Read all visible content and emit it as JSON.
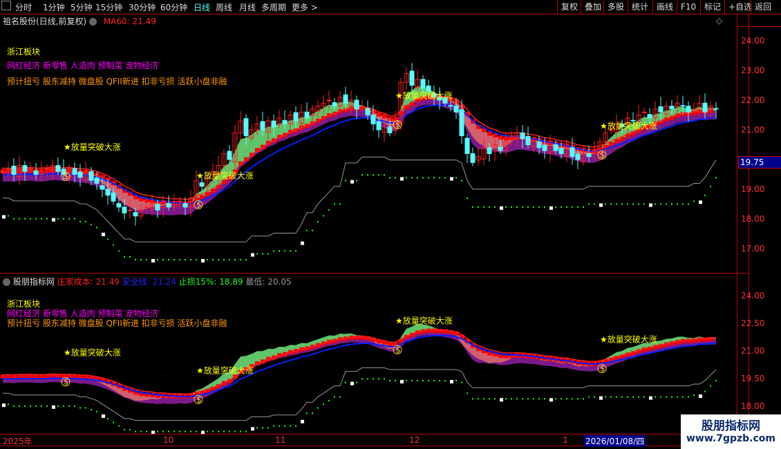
{
  "toolbar": {
    "periods": [
      "分时",
      "1分钟",
      "5分钟",
      "15分钟",
      "30分钟",
      "60分钟",
      "日线",
      "周线",
      "月线",
      "多周期",
      "更多 >"
    ],
    "active": "日线",
    "right_buttons": [
      "复权",
      "叠加",
      "多股",
      "统计",
      "画线",
      "F10",
      "标记",
      "+自选",
      "返回"
    ]
  },
  "main_pane": {
    "title": "祖名股份(日线,前复权)",
    "ma_label": "MA60: 21.49",
    "price_marker": "19.75",
    "axis_ticks": [
      "24.00",
      "23.00",
      "22.00",
      "21.00",
      "19.00",
      "18.00",
      "17.00"
    ]
  },
  "indicator_pane": {
    "name": "股朋指标网",
    "cost_label": "庄家成本: 21.49",
    "safe_label": "安全线: 21.24",
    "stop_label": "止损15%: 18.89",
    "low_label": "最低: 20.05",
    "axis_ticks": [
      "24.00",
      "22.50",
      "21.00",
      "19.50",
      "18.00"
    ]
  },
  "annotations": {
    "sector": "浙江板块",
    "concepts": "网红经济 新零售 人造肉 预制菜 宠物经济",
    "tags": "预计扭亏 股东减持 微盘股 QFII新进 扣非亏损 活跃小盘非融",
    "signal": "★放量突破大涨"
  },
  "date_axis": [
    "2025年",
    "10",
    "11",
    "12",
    "1",
    "2026/01/08/四"
  ],
  "watermark": {
    "name": "股朋指标网",
    "url": "www.7gpzb.com"
  },
  "colors": {
    "up": "#ff2020",
    "down": "#54ffff",
    "ma": "#ff2020",
    "safe": "#0020ff",
    "band_up": "#5fc46a",
    "band_down": "#d0606e",
    "band_low": "#7a1a8a",
    "stop": "#999999"
  },
  "chart_data": {
    "type": "candlestick",
    "ylim_main": [
      16.6,
      24.4
    ],
    "ylim_indicator": [
      17.8,
      24.4
    ],
    "x_labels": [
      "2025年",
      "10",
      "11",
      "12",
      "1"
    ],
    "close": [
      19.6,
      19.7,
      19.5,
      19.8,
      19.6,
      19.7,
      19.5,
      19.6,
      19.7,
      19.8,
      19.6,
      19.5,
      19.7,
      19.5,
      19.4,
      19.6,
      19.3,
      19.2,
      19.0,
      18.8,
      18.6,
      18.4,
      18.2,
      18.3,
      18.1,
      18.3,
      18.4,
      18.5,
      18.3,
      18.6,
      18.4,
      18.5,
      18.6,
      18.4,
      18.7,
      19.3,
      19.1,
      19.4,
      19.6,
      19.8,
      20.2,
      20.0,
      20.9,
      21.3,
      20.8,
      21.0,
      21.2,
      21.0,
      21.3,
      21.1,
      21.4,
      21.2,
      21.5,
      21.3,
      21.6,
      21.4,
      21.7,
      21.8,
      21.9,
      22.0,
      21.8,
      22.1,
      21.9,
      22.0,
      21.7,
      21.8,
      21.5,
      21.2,
      21.0,
      21.1,
      20.9,
      21.3,
      22.6,
      22.9,
      22.5,
      22.7,
      22.4,
      22.3,
      22.1,
      22.0,
      21.9,
      21.8,
      21.6,
      20.8,
      20.2,
      19.9,
      20.1,
      20.4,
      20.2,
      20.5,
      20.3,
      20.6,
      20.8,
      20.9,
      20.7,
      20.5,
      20.6,
      20.4,
      20.3,
      20.5,
      20.3,
      20.2,
      20.4,
      20.1,
      20.0,
      20.2,
      20.1,
      20.3,
      20.6,
      20.9,
      21.0,
      21.2,
      21.1,
      21.4,
      21.3,
      21.5,
      21.6,
      21.4,
      21.7,
      21.6,
      21.8,
      21.7,
      21.9,
      21.8,
      21.6,
      21.7,
      21.9,
      21.6,
      21.8,
      21.7
    ],
    "signal_bars": [
      11,
      35,
      71,
      108
    ]
  }
}
